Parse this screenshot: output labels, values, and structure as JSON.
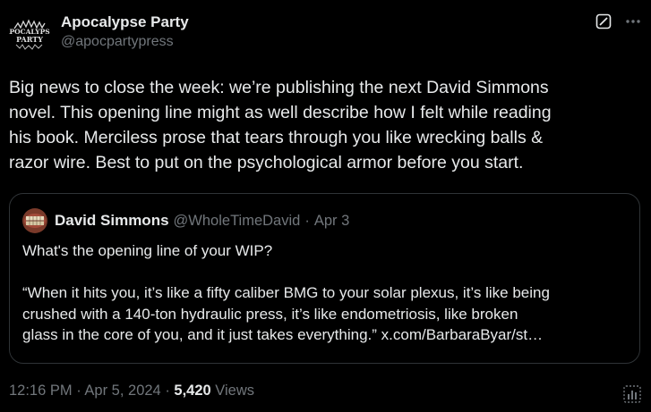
{
  "author": {
    "display_name": "Apocalypse Party",
    "handle": "@apocpartypress",
    "avatar_icon": "band-logo-avatar"
  },
  "header_icons": {
    "grok": "grok-icon",
    "more": "more-icon"
  },
  "tweet": {
    "lines": [
      "Big news to close the week: we’re publishing the next David Simmons",
      "novel. This opening line might as well describe how I felt while reading",
      "his book. Merciless prose that tears through you like wrecking balls &",
      "razor wire. Best to put on the psychological armor before you start."
    ]
  },
  "quote": {
    "display_name": "David Simmons",
    "handle": "@WholeTimeDavid",
    "separator": "·",
    "date": "Apr 3",
    "question": "What's the opening line of your WIP?",
    "lines": [
      "“When it hits you, it’s like a fifty caliber BMG to your solar plexus, it’s like being",
      "crushed with a 140-ton hydraulic press, it’s like endometriosis, like broken",
      "glass in the core of you, and it just takes everything.” x.com/BarbaraByar/st…"
    ]
  },
  "footer": {
    "time": "12:16 PM",
    "sep1": "·",
    "date": "Apr 5, 2024",
    "sep2": "·",
    "views_count": "5,420",
    "views_label": "Views"
  },
  "colors": {
    "background": "#000000",
    "text": "#e7e9ea",
    "muted": "#71767b",
    "border": "#2f3336"
  }
}
